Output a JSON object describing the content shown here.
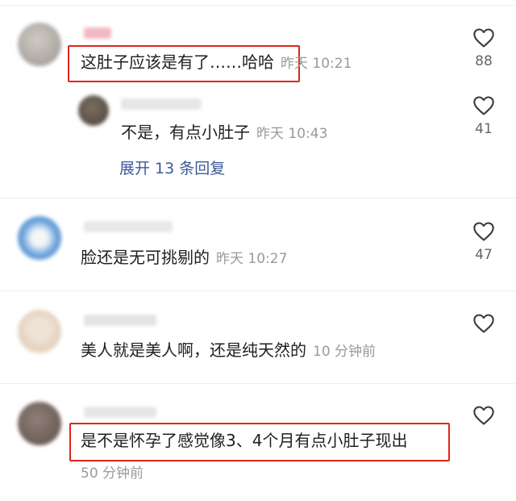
{
  "comments": [
    {
      "text": "这肚子应该是有了……哈哈",
      "time": "昨天 10:21",
      "likes": "88",
      "reply": {
        "text": "不是，有点小肚子",
        "time": "昨天 10:43",
        "likes": "41"
      },
      "expand_label": "展开 13 条回复"
    },
    {
      "text": "脸还是无可挑剔的",
      "time": "昨天 10:27",
      "likes": "47"
    },
    {
      "text": "美人就是美人啊，还是纯天然的",
      "time": "10 分钟前",
      "likes": ""
    },
    {
      "text": "是不是怀孕了感觉像3、4个月有点小肚子现出",
      "time": "50 分钟前",
      "likes": ""
    }
  ],
  "colors": {
    "highlight_box": "#e0261b",
    "link": "#3b5a9a",
    "muted": "#9a9a9a"
  },
  "icons": {
    "like": "heart-outline-icon"
  }
}
